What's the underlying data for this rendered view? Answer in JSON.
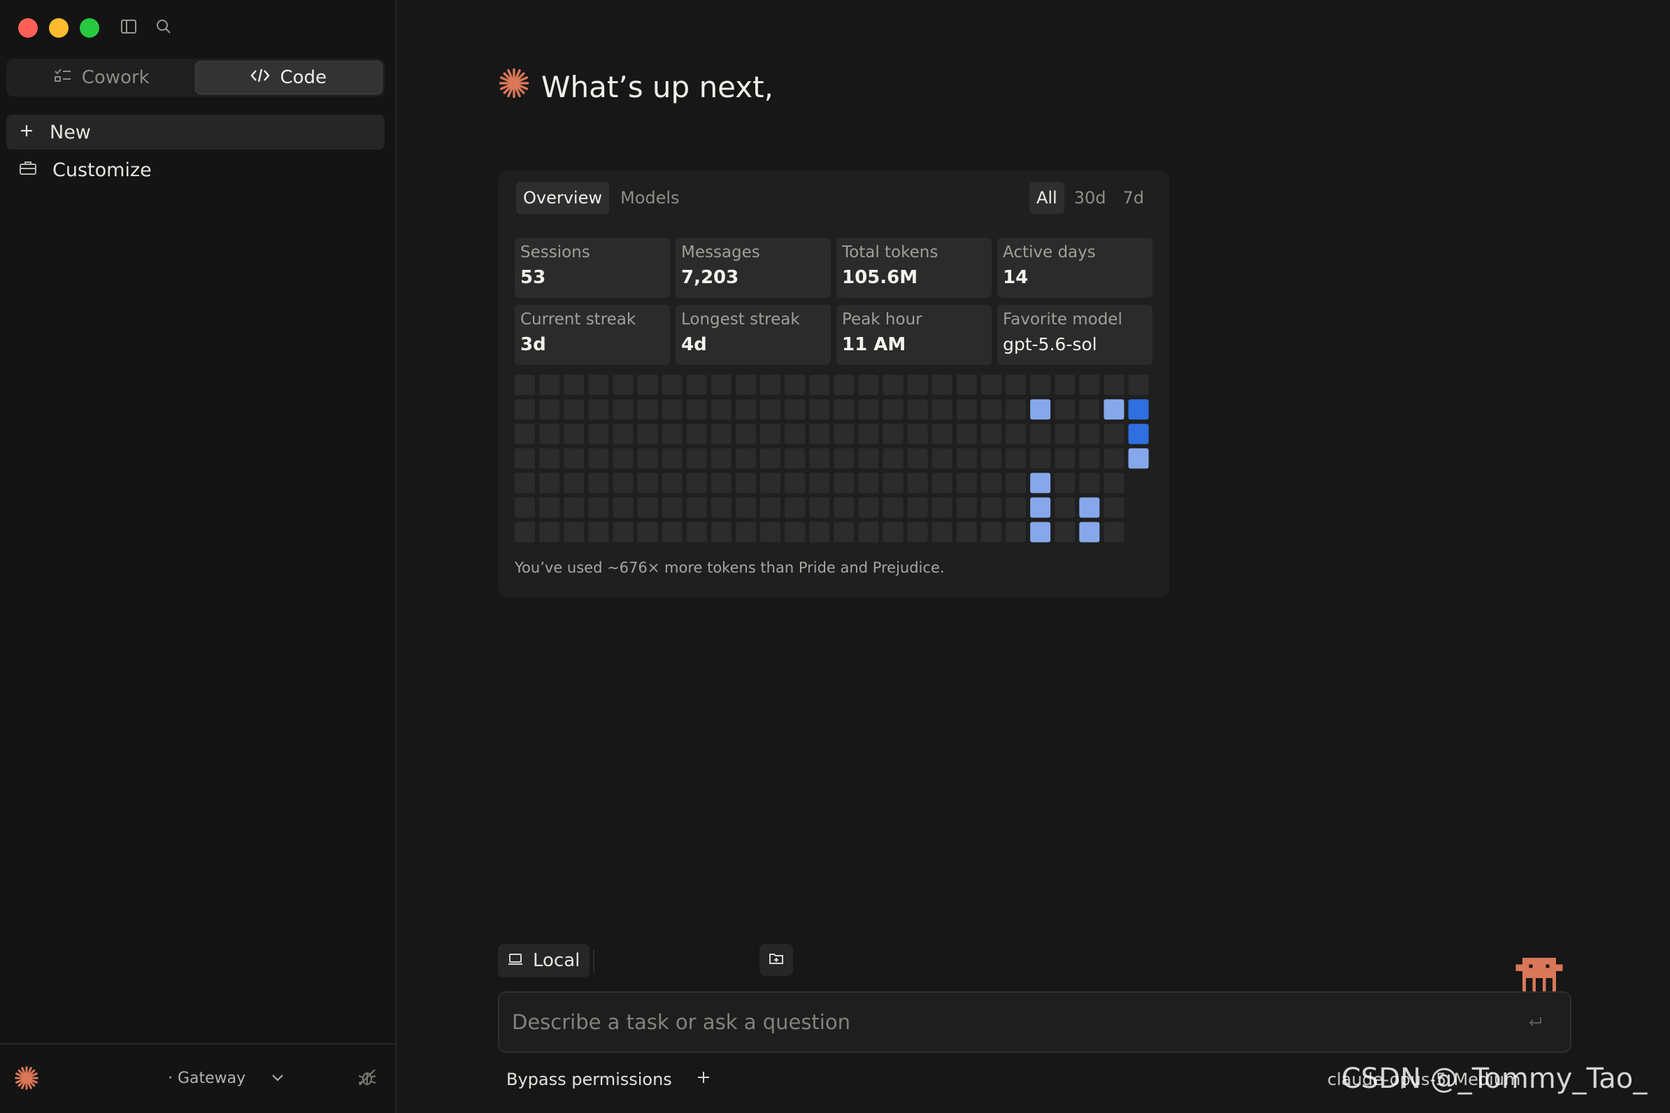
{
  "sidebar": {
    "modes": [
      {
        "label": "Cowork",
        "active": false
      },
      {
        "label": "Code",
        "active": true
      }
    ],
    "items": [
      {
        "label": "New",
        "icon": "plus-icon"
      },
      {
        "label": "Customize",
        "icon": "briefcase-icon"
      }
    ],
    "footer": {
      "gateway_label": "· Gateway"
    }
  },
  "main": {
    "greeting": "What’s up next,",
    "stats": {
      "tabs": [
        "Overview",
        "Models"
      ],
      "active_tab": "Overview",
      "ranges": [
        "All",
        "30d",
        "7d"
      ],
      "active_range": "All",
      "cards": [
        {
          "label": "Sessions",
          "value": "53"
        },
        {
          "label": "Messages",
          "value": "7,203"
        },
        {
          "label": "Total tokens",
          "value": "105.6M"
        },
        {
          "label": "Active days",
          "value": "14"
        },
        {
          "label": "Current streak",
          "value": "3d"
        },
        {
          "label": "Longest streak",
          "value": "4d"
        },
        {
          "label": "Peak hour",
          "value": "11 AM"
        },
        {
          "label": "Favorite model",
          "value": "gpt-5.6-sol"
        }
      ],
      "heatmap": {
        "rows": 7,
        "cols": 26,
        "colors": {
          "empty": "#2c2c2c",
          "light": "#86a8ea",
          "dark": "#2f6fe0"
        },
        "active_cells": [
          {
            "row": 1,
            "col": 21,
            "level": "light"
          },
          {
            "row": 1,
            "col": 24,
            "level": "light"
          },
          {
            "row": 1,
            "col": 25,
            "level": "dark"
          },
          {
            "row": 2,
            "col": 25,
            "level": "dark"
          },
          {
            "row": 3,
            "col": 25,
            "level": "light"
          },
          {
            "row": 4,
            "col": 21,
            "level": "light"
          },
          {
            "row": 5,
            "col": 21,
            "level": "light"
          },
          {
            "row": 5,
            "col": 23,
            "level": "light"
          },
          {
            "row": 6,
            "col": 21,
            "level": "light"
          },
          {
            "row": 6,
            "col": 23,
            "level": "light"
          }
        ],
        "last_col_rows": 4
      },
      "footnote": "You’ve used ~676× more tokens than Pride and Prejudice."
    }
  },
  "composer": {
    "environment": "Local",
    "placeholder": "Describe a task or ask a question",
    "permissions": "Bypass permissions",
    "model": "claude-opus-5",
    "effort": "Medium"
  },
  "watermark": "CSDN @_Tommy_Tao_",
  "colors": {
    "accent": "#d97757",
    "background": "#171717",
    "sidebar": "#141414"
  }
}
